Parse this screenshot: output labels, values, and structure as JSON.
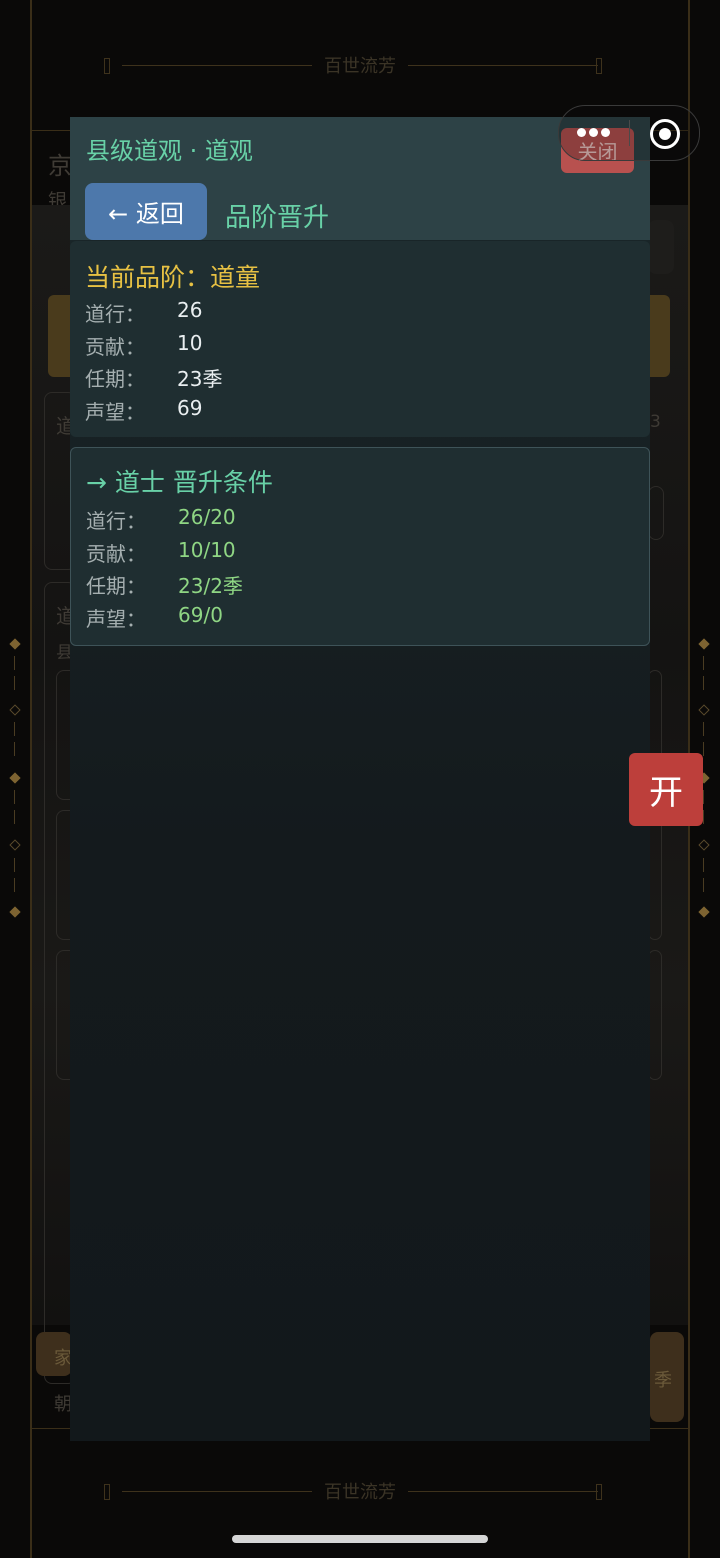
{
  "background": {
    "banner_title": "百世流芳",
    "left_fragments": [
      "京",
      "银",
      "道",
      "道",
      "县",
      "家",
      "朝"
    ],
    "right_fragments": [
      "3",
      "季"
    ]
  },
  "modal": {
    "title": "县级道观 · 道观",
    "close_label": "关闭",
    "back_label": "← 返回",
    "section_title": "品阶晋升",
    "current": {
      "title": "当前品阶：道童",
      "stats": [
        {
          "label": "道行：",
          "value": "26"
        },
        {
          "label": "贡献：",
          "value": "10"
        },
        {
          "label": "任期：",
          "value": "23季"
        },
        {
          "label": "声望：",
          "value": "69"
        }
      ]
    },
    "next": {
      "title": "→ 道士 晋升条件",
      "requirements": [
        {
          "label": "道行：",
          "value": "26/20"
        },
        {
          "label": "贡献：",
          "value": "10/10"
        },
        {
          "label": "任期：",
          "value": "23/2季"
        },
        {
          "label": "声望：",
          "value": "69/0"
        }
      ]
    }
  },
  "floating": {
    "open_label": "开"
  },
  "colors": {
    "accent_green": "#68d1a7",
    "gold": "#e7c143",
    "met_green": "#8fd684",
    "close_red": "#b8514f",
    "back_blue": "#4d78ab",
    "open_red": "#bd3f3b"
  }
}
